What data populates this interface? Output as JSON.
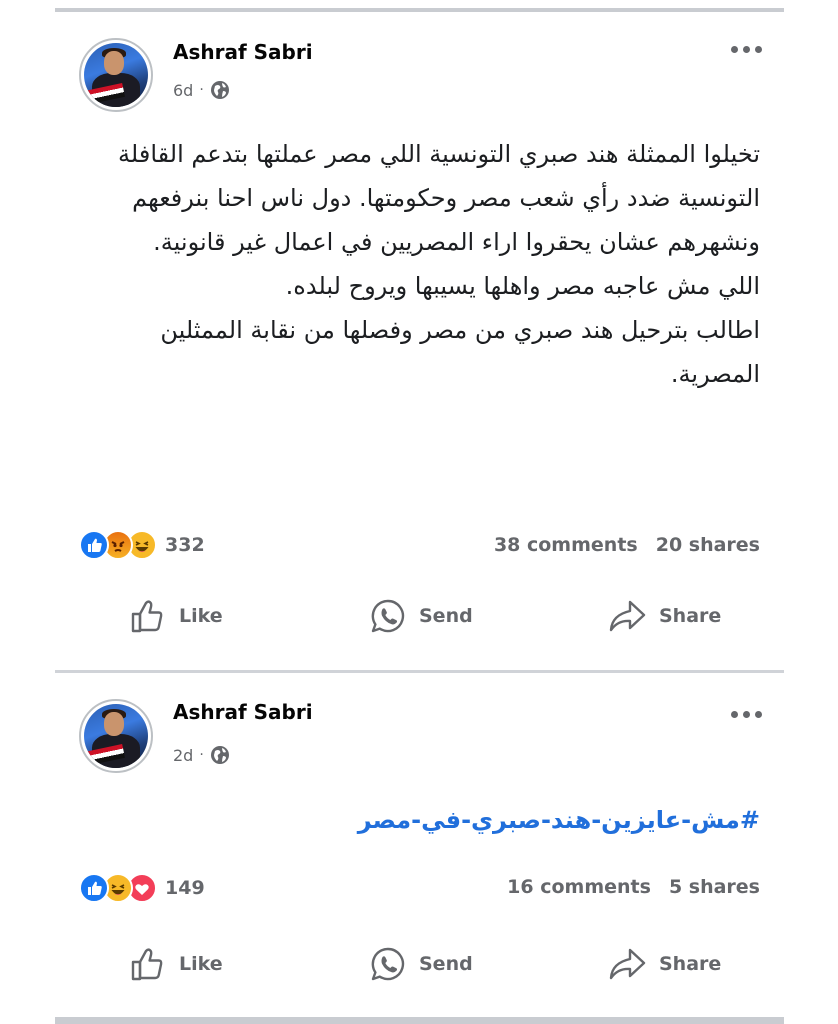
{
  "posts": [
    {
      "author": "Ashraf Sabri",
      "time": "6d",
      "separator": "·",
      "body": [
        "تخيلوا الممثلة هند صبري التونسية اللي مصر عملتها بتدعم القافلة التونسية ضدد رأي شعب مصر وحكومتها. دول ناس احنا بنرفعهم ونشهرهم عشان يحقروا اراء المصريين في اعمال غير قانونية.",
        "اللي مش عاجبه مصر واهلها يسيبها ويروح لبلده.",
        "اطالب بترحيل هند صبري من مصر وفصلها من نقابة الممثلين المصرية."
      ],
      "reactions": [
        "like-icon",
        "angry-icon",
        "haha-icon"
      ],
      "reaction_count": "332",
      "comments": "38 comments",
      "shares": "20 shares",
      "actions": {
        "like": "Like",
        "send": "Send",
        "share": "Share"
      }
    },
    {
      "author": "Ashraf Sabri",
      "time": "2d",
      "separator": "·",
      "hashtag": "#مش-عايزين-هند-صبري-في-مصر",
      "reactions": [
        "like-icon",
        "haha-icon",
        "love-icon"
      ],
      "reaction_count": "149",
      "comments": "16 comments",
      "shares": "5 shares",
      "actions": {
        "like": "Like",
        "send": "Send",
        "share": "Share"
      }
    }
  ],
  "colors": {
    "accent": "#1877f2",
    "hashtag": "#216fdb",
    "muted": "#65676b",
    "divider": "#c9ccd1"
  }
}
